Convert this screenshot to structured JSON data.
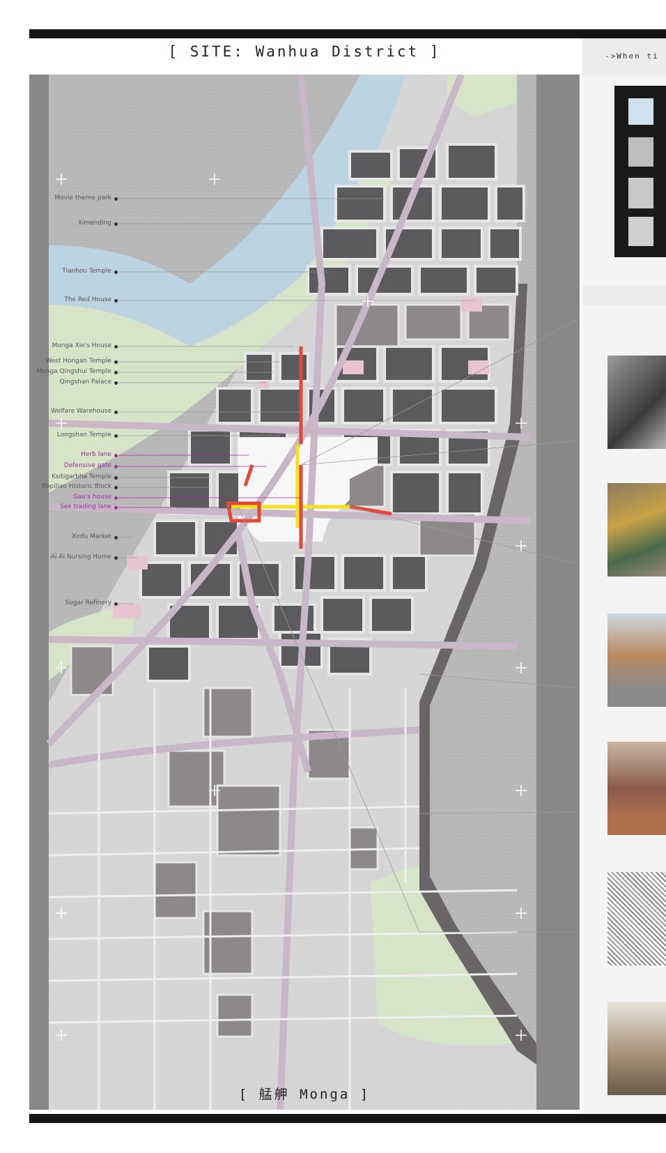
{
  "title": "[ SITE:  Wanhua District ]",
  "subtitle": "[   艋舺 Monga   ]",
  "side_text": "->When ti",
  "colors": {
    "water": "#bcd3e2",
    "green": "#d8e4c8",
    "road": "#c9b7c7",
    "block_dark": "#5b5a5c",
    "block_light": "#d3d3d3",
    "highlight_red": "#e0493a",
    "highlight_yellow": "#f2e21e",
    "label_purple": "#9b2e9d"
  },
  "labels": [
    {
      "text": "Movie theme park",
      "color": "gray"
    },
    {
      "text": "Ximending",
      "color": "gray"
    },
    {
      "text": "Tianhou Temple",
      "color": "gray"
    },
    {
      "text": "The Red House",
      "color": "gray"
    },
    {
      "text": "Monga Xie's House",
      "color": "gray"
    },
    {
      "text": "West Hongan Temple",
      "color": "gray"
    },
    {
      "text": "Monga Qingshui Temple",
      "color": "gray"
    },
    {
      "text": "Qingshan Palace",
      "color": "gray"
    },
    {
      "text": "Welfare Warehouse",
      "color": "gray"
    },
    {
      "text": "Longshan Temple",
      "color": "gray"
    },
    {
      "text": "Herb lane",
      "color": "purple"
    },
    {
      "text": "Defensive gate",
      "color": "purple"
    },
    {
      "text": "Ksitigarbha Temple",
      "color": "gray"
    },
    {
      "text": "Bopiliao Historic Block",
      "color": "gray"
    },
    {
      "text": "Gao's house",
      "color": "purple"
    },
    {
      "text": "Sex trading lane",
      "color": "purple"
    },
    {
      "text": "Xinfu Market",
      "color": "gray"
    },
    {
      "text": "Ai Ai Nursing Home",
      "color": "gray"
    },
    {
      "text": "Sugar Refinery",
      "color": "gray"
    }
  ],
  "thumbnails": [
    {
      "name": "storyboard-thumbnail"
    },
    {
      "name": "street-photo-1"
    },
    {
      "name": "street-photo-2"
    },
    {
      "name": "street-photo-3"
    },
    {
      "name": "market-photo"
    },
    {
      "name": "historic-map-photo"
    },
    {
      "name": "temple-photo"
    }
  ]
}
